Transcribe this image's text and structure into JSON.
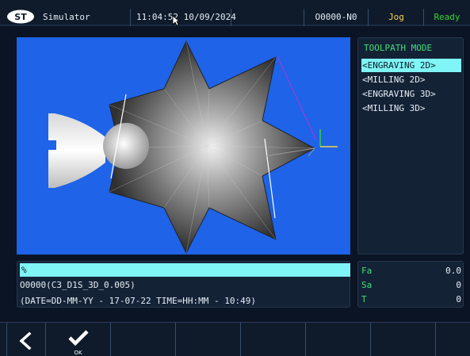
{
  "topbar": {
    "app_title": "Simulator",
    "clock": "11:04:52 10/09/2024",
    "program": "O0000-N0",
    "mode": "Jog",
    "state": "Ready",
    "logo_icon": "st-logo-icon",
    "colors": {
      "mode": "#f4d54a",
      "state": "#35d535"
    }
  },
  "viewport": {
    "background": "#1e63e8",
    "contents": [
      "star-part-render",
      "tool-axis-icon"
    ]
  },
  "toolpath": {
    "title": "TOOLPATH MODE",
    "modes": [
      {
        "label": "<ENGRAVING 2D>",
        "active": true
      },
      {
        "label": "<MILLING 2D>",
        "active": false
      },
      {
        "label": "<ENGRAVING 3D>",
        "active": false
      },
      {
        "label": "<MILLING 3D>",
        "active": false
      }
    ]
  },
  "program_panel": {
    "highlight": "%",
    "line1": "O0000(C3_D1S_3D_0.005)",
    "line2": "(DATE=DD-MM-YY - 17-07-22 TIME=HH:MM - 10:49)"
  },
  "feed": {
    "rows": [
      {
        "label": "Fa",
        "value": "0.0"
      },
      {
        "label": "Sa",
        "value": "0"
      },
      {
        "label": "T",
        "value": "0"
      }
    ]
  },
  "softkeys": {
    "back_icon": "chevron-left-icon",
    "ok_icon": "checkmark-icon",
    "ok_label": "OK"
  }
}
